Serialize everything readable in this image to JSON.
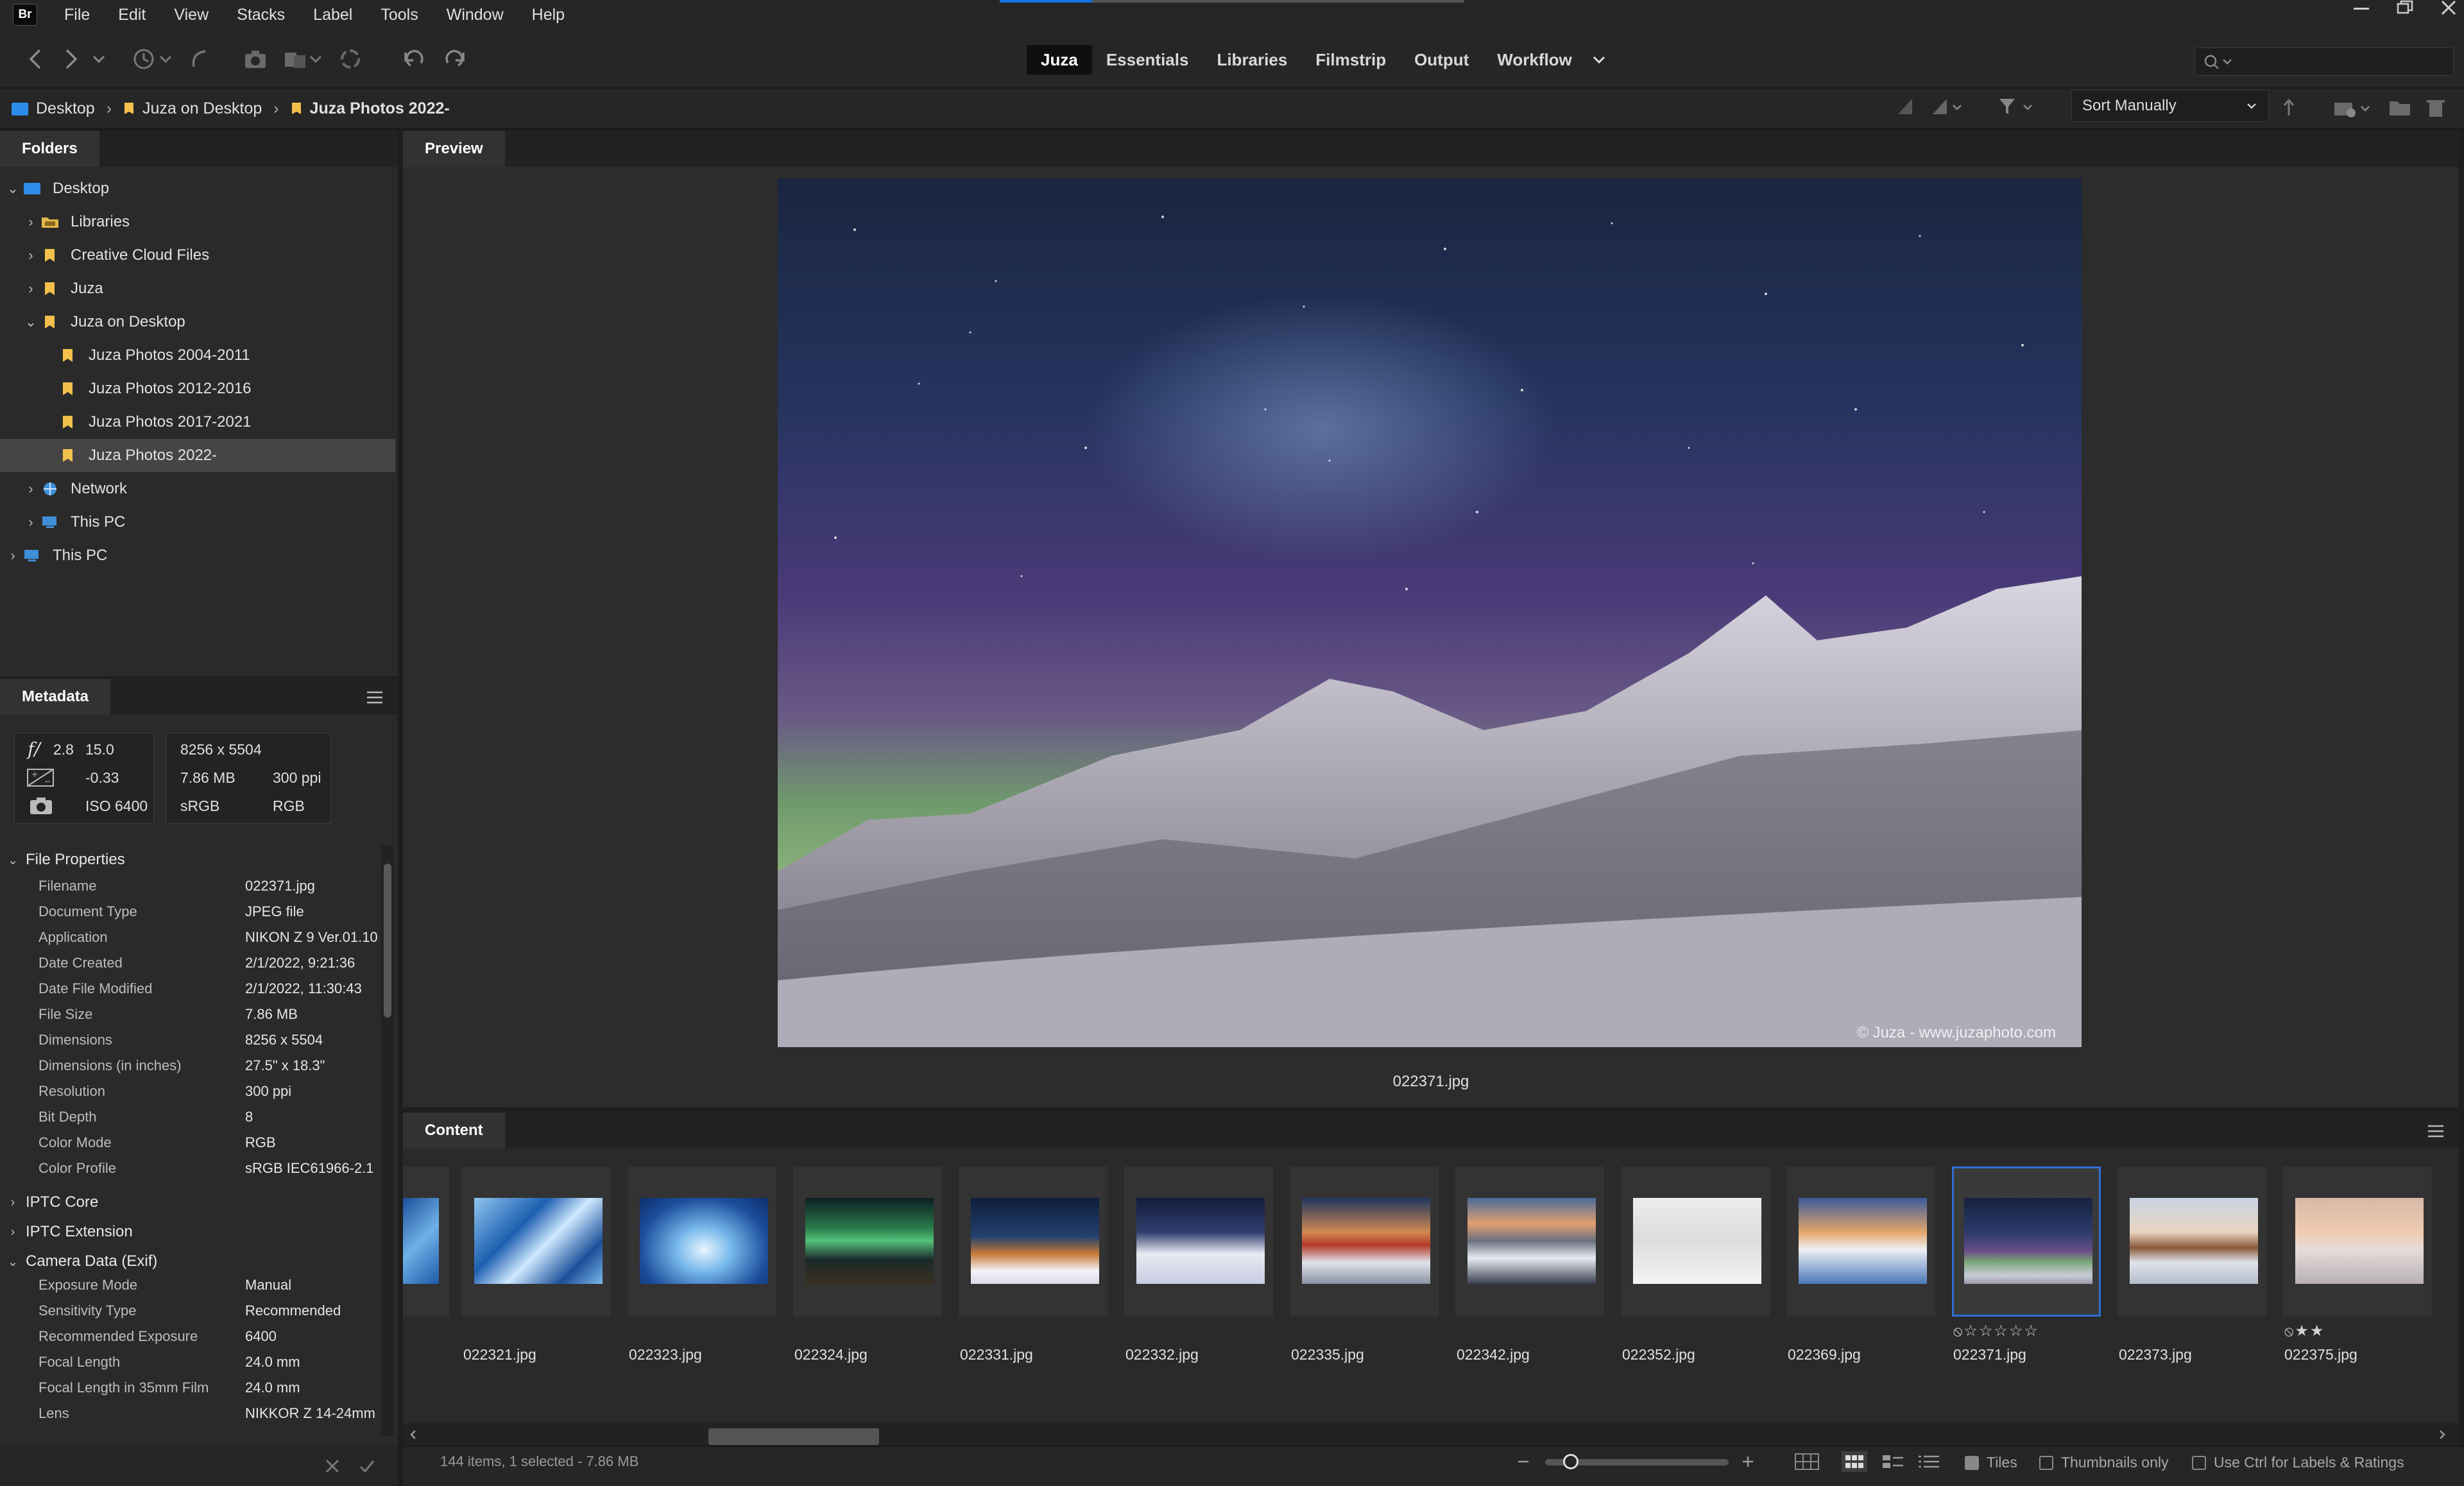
{
  "app": {
    "logo": "Br"
  },
  "menu": [
    "File",
    "Edit",
    "View",
    "Stacks",
    "Label",
    "Tools",
    "Window",
    "Help"
  ],
  "workspaces": [
    {
      "label": "Juza",
      "active": true
    },
    {
      "label": "Essentials",
      "active": false
    },
    {
      "label": "Libraries",
      "active": false
    },
    {
      "label": "Filmstrip",
      "active": false
    },
    {
      "label": "Output",
      "active": false
    },
    {
      "label": "Workflow",
      "active": false
    }
  ],
  "breadcrumb": [
    "Desktop",
    "Juza on Desktop",
    "Juza Photos 2022-"
  ],
  "sort": {
    "label": "Sort Manually"
  },
  "folders": {
    "tab": "Folders",
    "items": [
      {
        "label": "Desktop",
        "selected": false
      },
      {
        "label": "Libraries",
        "selected": false
      },
      {
        "label": "Creative Cloud Files",
        "selected": false
      },
      {
        "label": "Juza",
        "selected": false
      },
      {
        "label": "Juza on Desktop",
        "selected": false
      },
      {
        "label": "Juza Photos 2004-2011",
        "selected": false
      },
      {
        "label": "Juza Photos 2012-2016",
        "selected": false
      },
      {
        "label": "Juza Photos 2017-2021",
        "selected": false
      },
      {
        "label": "Juza Photos 2022-",
        "selected": true
      },
      {
        "label": "Network",
        "selected": false
      },
      {
        "label": "This PC",
        "selected": false
      },
      {
        "label": "This PC",
        "selected": false
      }
    ]
  },
  "metadata": {
    "tab": "Metadata",
    "summary": {
      "aperture_prefix": "f/",
      "aperture": "2.8",
      "shutter": "15.0",
      "exposure_comp": "-0.33",
      "iso": "ISO 6400",
      "dimensions": "8256 x 5504",
      "size": "7.86 MB",
      "resolution": "300 ppi",
      "color_space": "sRGB",
      "color_mode": "RGB"
    },
    "sections": {
      "file_properties": "File Properties",
      "iptc_core": "IPTC Core",
      "iptc_extension": "IPTC Extension",
      "camera_data": "Camera Data (Exif)"
    },
    "file_properties": [
      {
        "k": "Filename",
        "v": "022371.jpg"
      },
      {
        "k": "Document Type",
        "v": "JPEG file"
      },
      {
        "k": "Application",
        "v": "NIKON Z 9 Ver.01.10"
      },
      {
        "k": "Date Created",
        "v": "2/1/2022, 9:21:36"
      },
      {
        "k": "Date File Modified",
        "v": "2/1/2022, 11:30:43"
      },
      {
        "k": "File Size",
        "v": "7.86 MB"
      },
      {
        "k": "Dimensions",
        "v": "8256 x 5504"
      },
      {
        "k": "Dimensions (in inches)",
        "v": "27.5\" x 18.3\""
      },
      {
        "k": "Resolution",
        "v": "300 ppi"
      },
      {
        "k": "Bit Depth",
        "v": "8"
      },
      {
        "k": "Color Mode",
        "v": "RGB"
      },
      {
        "k": "Color Profile",
        "v": "sRGB IEC61966-2.1"
      }
    ],
    "camera_data": [
      {
        "k": "Exposure Mode",
        "v": "Manual"
      },
      {
        "k": "Sensitivity Type",
        "v": "Recommended"
      },
      {
        "k": "Recommended Exposure",
        "v": "6400"
      },
      {
        "k": "Focal Length",
        "v": "24.0 mm"
      },
      {
        "k": "Focal Length in 35mm Film",
        "v": "24.0 mm"
      },
      {
        "k": "Lens",
        "v": "NIKKOR Z 14-24mm"
      }
    ]
  },
  "preview": {
    "tab": "Preview",
    "caption": "022371.jpg",
    "watermark": "© Juza - www.juzaphoto.com"
  },
  "content": {
    "tab": "Content",
    "items": [
      {
        "name": "022321.jpg",
        "selected": false,
        "theme": "ice"
      },
      {
        "name": "022323.jpg",
        "selected": false,
        "theme": "cave"
      },
      {
        "name": "022324.jpg",
        "selected": false,
        "theme": "aurora"
      },
      {
        "name": "022331.jpg",
        "selected": false,
        "theme": "cabin-night"
      },
      {
        "name": "022332.jpg",
        "selected": false,
        "theme": "trees"
      },
      {
        "name": "022335.jpg",
        "selected": false,
        "theme": "lighthouse"
      },
      {
        "name": "022342.jpg",
        "selected": false,
        "theme": "river"
      },
      {
        "name": "022352.jpg",
        "selected": false,
        "theme": "reindeer"
      },
      {
        "name": "022369.jpg",
        "selected": false,
        "theme": "lake"
      },
      {
        "name": "022371.jpg",
        "selected": true,
        "theme": "night-sky",
        "rating": 0
      },
      {
        "name": "022373.jpg",
        "selected": false,
        "theme": "hut"
      },
      {
        "name": "022375.jpg",
        "selected": false,
        "theme": "dusk",
        "rating": 2
      }
    ]
  },
  "status": {
    "text": "144 items, 1 selected - 7.86 MB",
    "tiles_label": "Tiles",
    "thumbnails_only_label": "Thumbnails only",
    "ctrl_labels_label": "Use Ctrl for Labels & Ratings"
  },
  "colors": {
    "accent": "#1473e6",
    "folder": "#f2c14b",
    "selection_border": "#2f6fd6"
  }
}
